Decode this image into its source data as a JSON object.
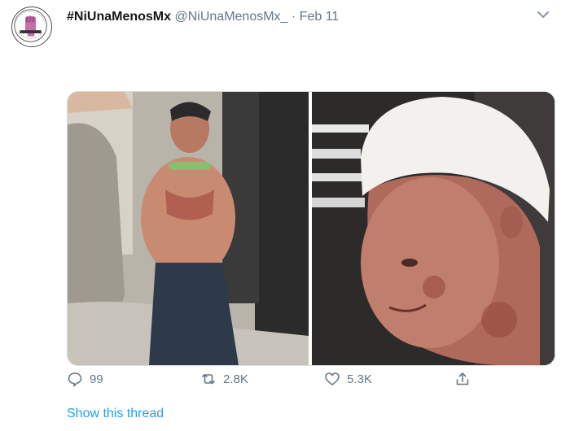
{
  "tweet": {
    "display_name": "#NiUnaMenosMx",
    "handle": "@NiUnaMenosMx_",
    "separator": "·",
    "date": "Feb 11",
    "avatar_icon": "raised-fist-logo-icon",
    "more_icon": "chevron-down-icon",
    "media": [
      {
        "name": "photo-left",
        "subject": "shirtless man beside car door"
      },
      {
        "name": "photo-right",
        "subject": "man with bandaged head in vehicle"
      }
    ],
    "actions": {
      "reply": {
        "icon": "reply-icon",
        "count": "99"
      },
      "retweet": {
        "icon": "retweet-icon",
        "count": "2.8K"
      },
      "like": {
        "icon": "heart-icon",
        "count": "5.3K"
      },
      "share": {
        "icon": "share-icon"
      }
    },
    "show_thread": "Show this thread"
  },
  "colors": {
    "link": "#1da1f2",
    "secondary_text": "#657786",
    "avatar_accent": "#c86fa8"
  }
}
